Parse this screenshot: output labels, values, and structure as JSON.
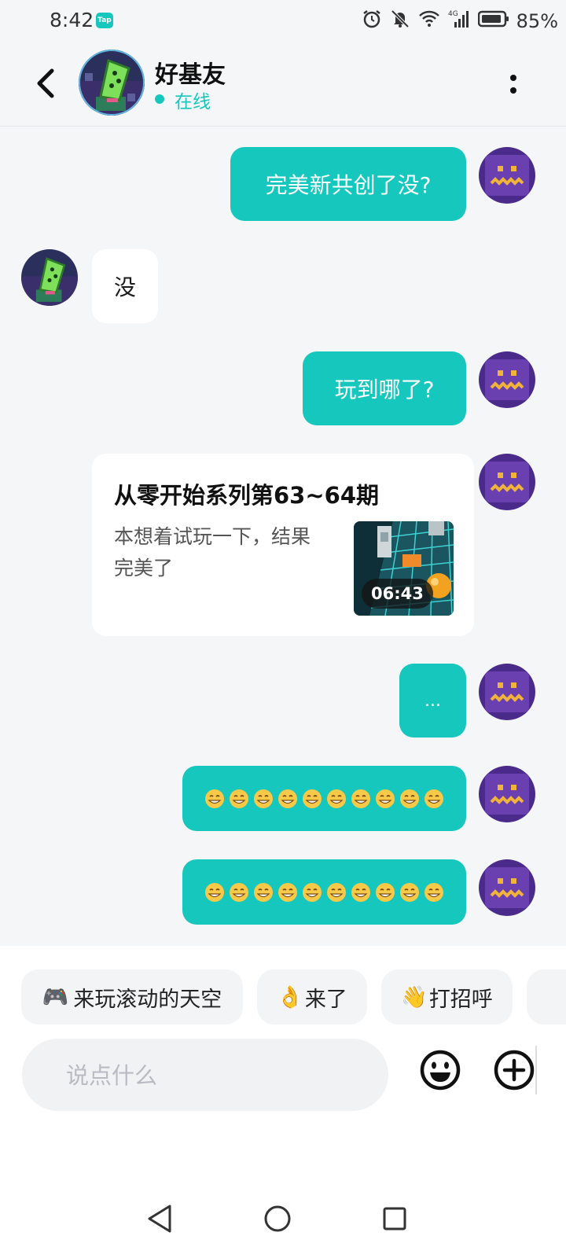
{
  "status_bar": {
    "time": "8:42",
    "app_badge": "Tap",
    "battery_percent": "85%",
    "network": "4G"
  },
  "header": {
    "contact_name": "好基友",
    "status": "在线"
  },
  "messages": [
    {
      "from": "me",
      "text": "完美新共创了没?"
    },
    {
      "from": "other",
      "text": "没"
    },
    {
      "from": "me",
      "text": "玩到哪了?"
    },
    {
      "from": "me",
      "type": "card",
      "title": "从零开始系列第63~64期",
      "description": "本想着试玩一下，结果完美了",
      "duration": "06:43"
    },
    {
      "from": "me",
      "text": "..."
    },
    {
      "from": "me",
      "type": "emoji",
      "emoji": "grinning-face",
      "count": 10
    },
    {
      "from": "me",
      "type": "emoji",
      "emoji": "grinning-face",
      "count": 10
    }
  ],
  "quick_replies": [
    {
      "icon": "🎮",
      "label": "来玩滚动的天空"
    },
    {
      "icon": "👌",
      "label": "来了"
    },
    {
      "icon": "👋",
      "label": "打招呼"
    }
  ],
  "composer": {
    "placeholder": "说点什么"
  },
  "colors": {
    "accent": "#16c7be",
    "background": "#f5f6f8"
  }
}
